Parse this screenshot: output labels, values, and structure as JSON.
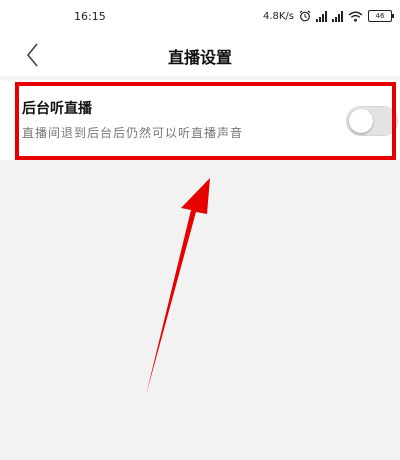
{
  "status_bar": {
    "time": "16:15",
    "network_speed": "4.8K/s",
    "battery_level": "46",
    "icons": [
      "alarm-icon",
      "signal-icon",
      "signal-icon",
      "wifi-icon",
      "battery-icon"
    ]
  },
  "header": {
    "back_icon": "chevron-left-icon",
    "title": "直播设置"
  },
  "setting": {
    "title": "后台听直播",
    "description": "直播间退到后台后仍然可以听直播声音",
    "toggle_on": false
  },
  "annotation": {
    "highlight_color": "#e60000",
    "arrow_color": "#e60000"
  }
}
